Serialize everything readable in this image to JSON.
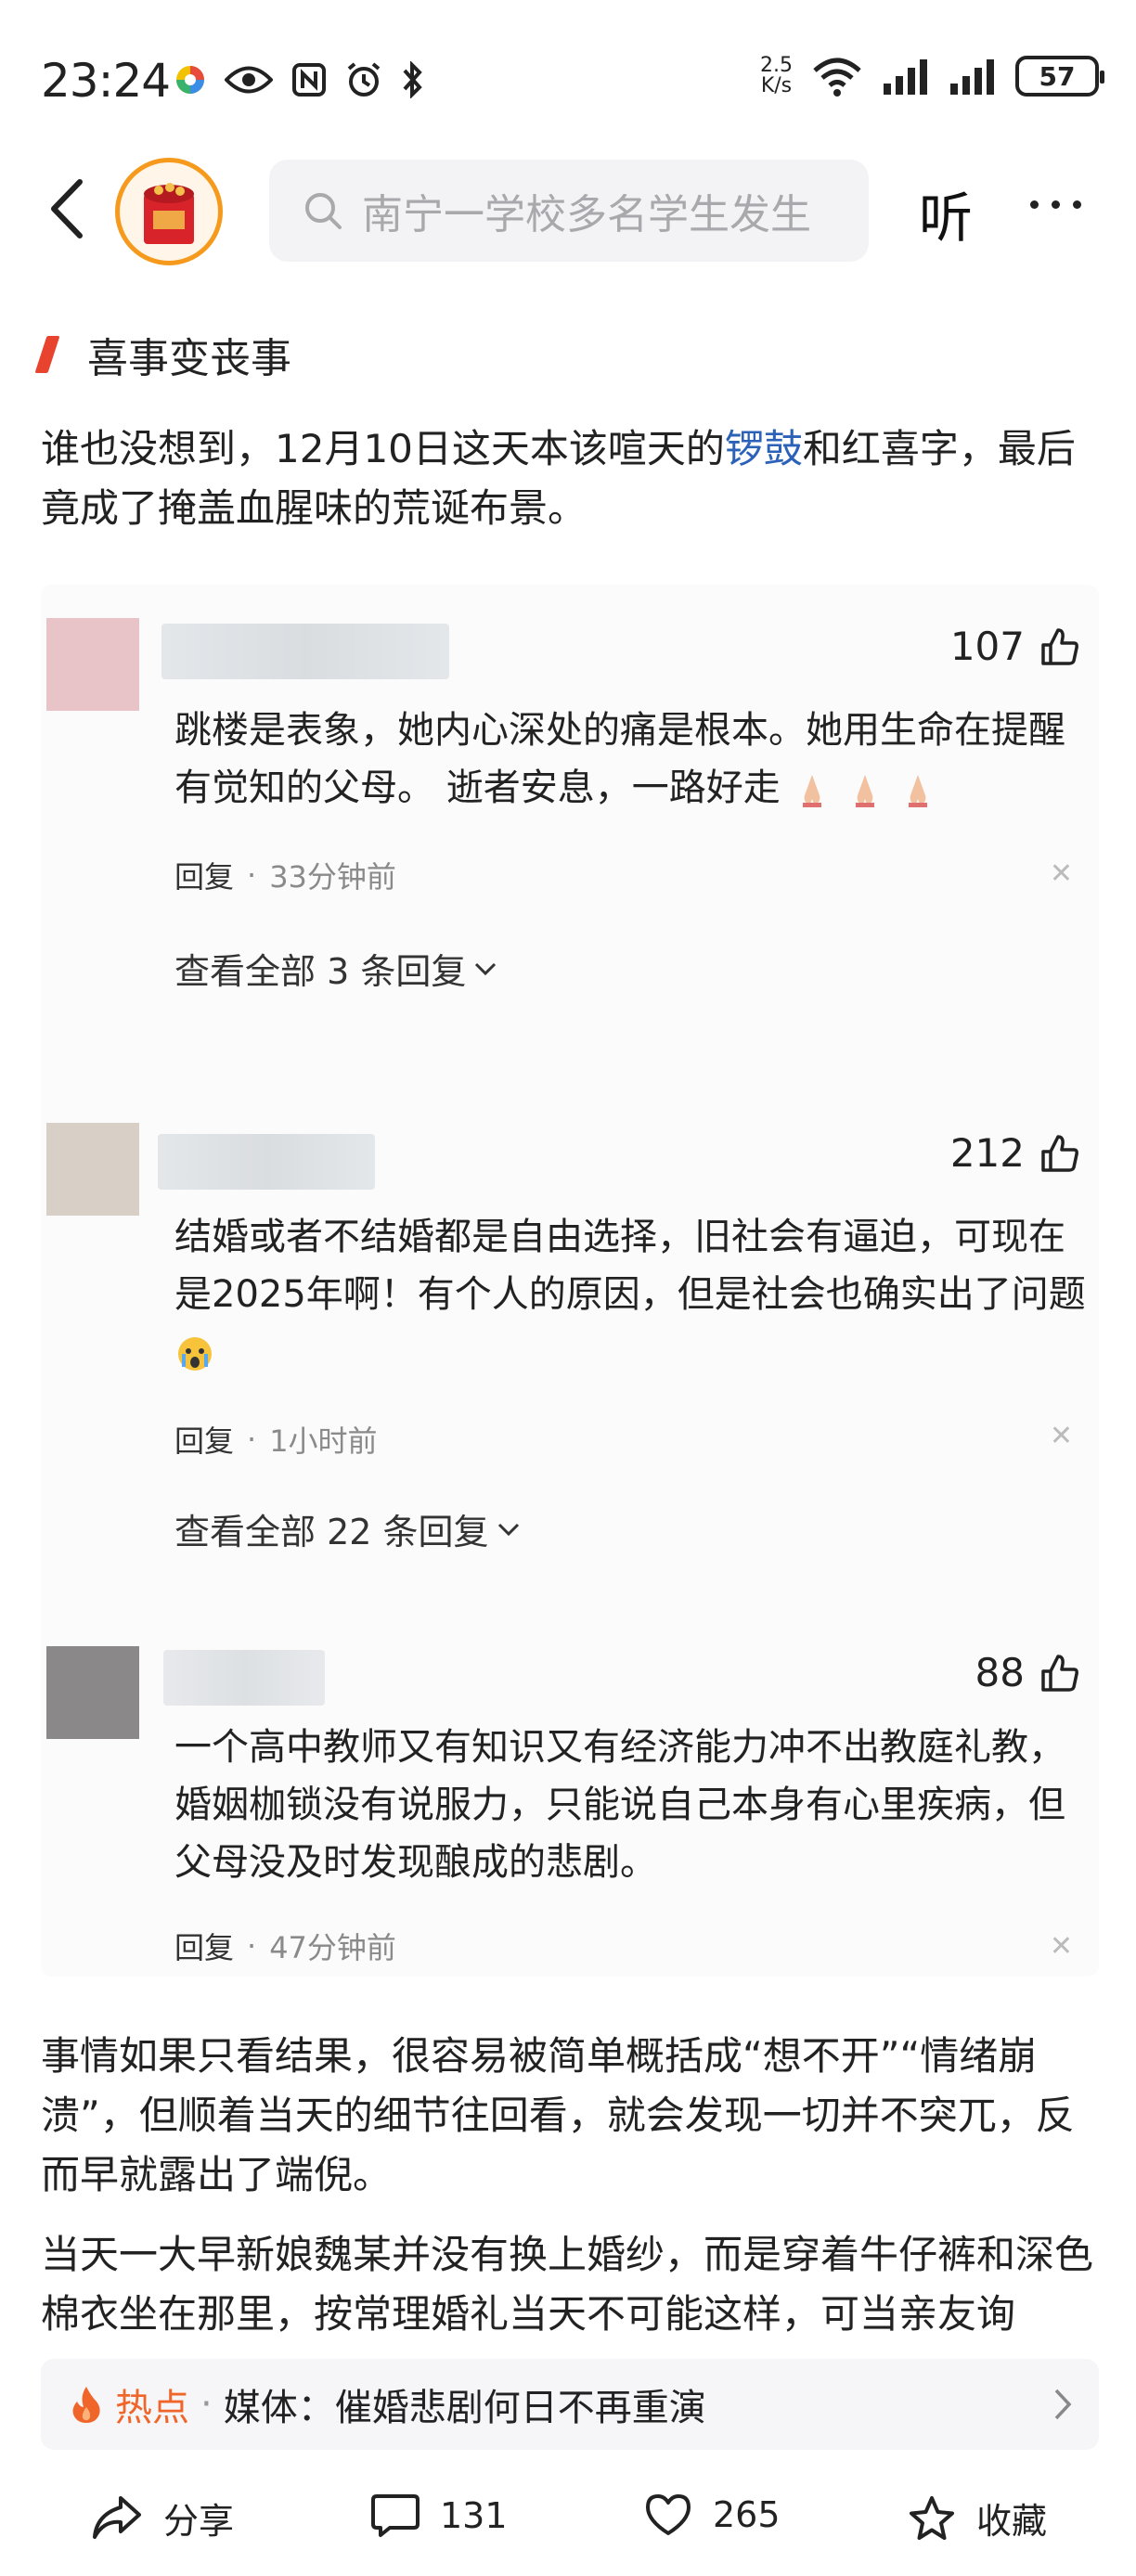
{
  "status_bar": {
    "time": "23:24",
    "net_speed_value": "2.5",
    "net_speed_unit": "K/s",
    "battery": "57"
  },
  "topnav": {
    "search_placeholder": "南宁一学校多名学生发生",
    "listen_label": "听"
  },
  "article": {
    "section_title": "喜事变丧事",
    "para1_before": "谁也没想到，12月10日这天本该喧天的",
    "para1_link": "锣鼓",
    "para1_after": "和红喜字，最后竟成了掩盖血腥味的荒诞布景。",
    "para2": "事情如果只看结果，很容易被简单概括成“想不开”“情绪崩溃”，但顺着当天的细节往回看，就会发现一切并不突兀，反而早就露出了端倪。",
    "para3": "当天一大早新娘魏某并没有换上婚纱，而是穿着牛仔裤和深色棉衣坐在那里，按常理婚礼当天不可能这样，可当亲友询"
  },
  "comments": [
    {
      "likes": "107",
      "text": "跳楼是表象，她内心深处的痛是根本。她用生命在提醒有觉知的父母。 逝者安息，一路好走",
      "reply_label": "回复",
      "dot": "·",
      "time": "33分钟前",
      "more": "查看全部 3 条回复"
    },
    {
      "likes": "212",
      "text": "结婚或者不结婚都是自由选择，旧社会有逼迫，可现在是2025年啊！有个人的原因，但是社会也确实出了问题",
      "reply_label": "回复",
      "dot": "·",
      "time": "1小时前",
      "more": "查看全部 22 条回复"
    },
    {
      "likes": "88",
      "text": "一个高中教师又有知识又有经济能力冲不出教庭礼教，婚姻枷锁没有说服力，只能说自己本身有心里疾病，但父母没及时发现酿成的悲剧。",
      "reply_label": "回复",
      "dot": "·",
      "time": "47分钟前"
    }
  ],
  "hot": {
    "label": "热点",
    "dot": "·",
    "text": "媒体：催婚悲剧何日不再重演"
  },
  "bottom_bar": {
    "share": "分享",
    "comments": "131",
    "likes": "265",
    "favorite": "收藏"
  },
  "colors": {
    "accent_orange": "#f0662a",
    "link_blue": "#2b62b8",
    "section_red": "#e8432f"
  }
}
